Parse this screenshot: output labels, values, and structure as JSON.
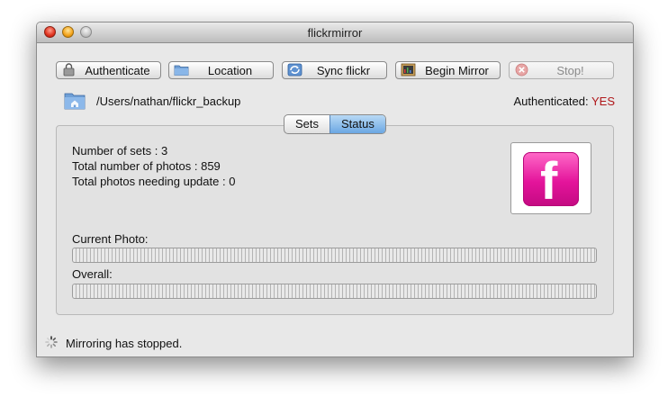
{
  "window": {
    "title": "flickrmirror"
  },
  "toolbar": {
    "authenticate": "Authenticate",
    "location": "Location",
    "sync": "Sync flickr",
    "begin": "Begin Mirror",
    "stop": "Stop!"
  },
  "path": "/Users/nathan/flickr_backup",
  "auth": {
    "label": "Authenticated:",
    "value": "YES",
    "value_color": "#b0171a"
  },
  "tabs": {
    "sets": "Sets",
    "status": "Status",
    "selected": "Status"
  },
  "stats": {
    "sets": "Number of sets : 3",
    "photos": "Total number of photos : 859",
    "needing_update": "Total photos needing update : 0"
  },
  "progress": {
    "current_label": "Current Photo:",
    "current_value": 0,
    "overall_label": "Overall:",
    "overall_value": 0
  },
  "status_text": "Mirroring has stopped.",
  "colors": {
    "logo_pink": "#e4149b",
    "tab_selected": "#6ba7e3"
  }
}
